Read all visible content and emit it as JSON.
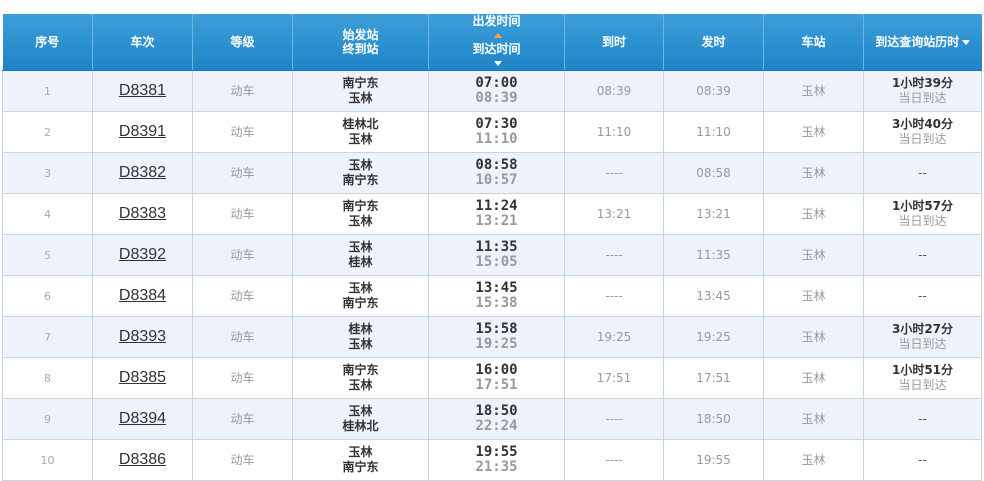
{
  "headers": {
    "seq": "序号",
    "train": "车次",
    "grade": "等级",
    "station_start": "始发站",
    "station_end": "终到站",
    "dep_time": "出发时间",
    "arr_time": "到达时间",
    "arrive": "到时",
    "depart": "发时",
    "stop": "车站",
    "duration": "到达查询站历时"
  },
  "rows": [
    {
      "seq": "1",
      "train": "D8381",
      "grade": "动车",
      "from": "南宁东",
      "to": "玉林",
      "dep": "07:00",
      "arr": "08:39",
      "arrive": "08:39",
      "depart": "08:39",
      "stop": "玉林",
      "dur": "1小时39分",
      "dur_sub": "当日到达"
    },
    {
      "seq": "2",
      "train": "D8391",
      "grade": "动车",
      "from": "桂林北",
      "to": "玉林",
      "dep": "07:30",
      "arr": "11:10",
      "arrive": "11:10",
      "depart": "11:10",
      "stop": "玉林",
      "dur": "3小时40分",
      "dur_sub": "当日到达"
    },
    {
      "seq": "3",
      "train": "D8382",
      "grade": "动车",
      "from": "玉林",
      "to": "南宁东",
      "dep": "08:58",
      "arr": "10:57",
      "arrive": "----",
      "depart": "08:58",
      "stop": "玉林",
      "dur": "--",
      "dur_sub": ""
    },
    {
      "seq": "4",
      "train": "D8383",
      "grade": "动车",
      "from": "南宁东",
      "to": "玉林",
      "dep": "11:24",
      "arr": "13:21",
      "arrive": "13:21",
      "depart": "13:21",
      "stop": "玉林",
      "dur": "1小时57分",
      "dur_sub": "当日到达"
    },
    {
      "seq": "5",
      "train": "D8392",
      "grade": "动车",
      "from": "玉林",
      "to": "桂林",
      "dep": "11:35",
      "arr": "15:05",
      "arrive": "----",
      "depart": "11:35",
      "stop": "玉林",
      "dur": "--",
      "dur_sub": ""
    },
    {
      "seq": "6",
      "train": "D8384",
      "grade": "动车",
      "from": "玉林",
      "to": "南宁东",
      "dep": "13:45",
      "arr": "15:38",
      "arrive": "----",
      "depart": "13:45",
      "stop": "玉林",
      "dur": "--",
      "dur_sub": ""
    },
    {
      "seq": "7",
      "train": "D8393",
      "grade": "动车",
      "from": "桂林",
      "to": "玉林",
      "dep": "15:58",
      "arr": "19:25",
      "arrive": "19:25",
      "depart": "19:25",
      "stop": "玉林",
      "dur": "3小时27分",
      "dur_sub": "当日到达"
    },
    {
      "seq": "8",
      "train": "D8385",
      "grade": "动车",
      "from": "南宁东",
      "to": "玉林",
      "dep": "16:00",
      "arr": "17:51",
      "arrive": "17:51",
      "depart": "17:51",
      "stop": "玉林",
      "dur": "1小时51分",
      "dur_sub": "当日到达"
    },
    {
      "seq": "9",
      "train": "D8394",
      "grade": "动车",
      "from": "玉林",
      "to": "桂林北",
      "dep": "18:50",
      "arr": "22:24",
      "arrive": "----",
      "depart": "18:50",
      "stop": "玉林",
      "dur": "--",
      "dur_sub": ""
    },
    {
      "seq": "10",
      "train": "D8386",
      "grade": "动车",
      "from": "玉林",
      "to": "南宁东",
      "dep": "19:55",
      "arr": "21:35",
      "arrive": "----",
      "depart": "19:55",
      "stop": "玉林",
      "dur": "--",
      "dur_sub": ""
    }
  ],
  "colors": {
    "header_bg": "#2a8fcf",
    "row_alt_bg": "#eef2fa",
    "sort_arrow": "#f7a23a"
  }
}
